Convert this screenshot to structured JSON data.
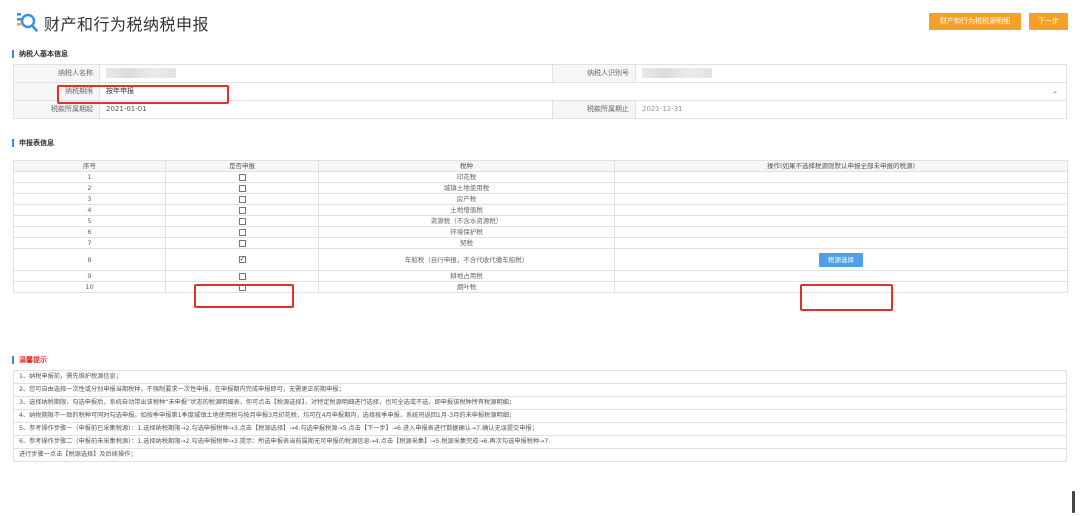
{
  "header": {
    "title": "财产和行为税纳税申报",
    "detail_button": "财产和行为税税源明细",
    "next_button": "下一步"
  },
  "basic_info": {
    "section_title": "纳税人基本信息",
    "taxpayer_name_label": "纳税人名称",
    "taxpayer_id_label": "纳税人识别号",
    "period_label": "纳税期限",
    "period_value": "按年申报",
    "start_label": "税款所属期起",
    "start_value": "2021-01-01",
    "end_label": "税款所属期止",
    "end_value": "2021-12-31"
  },
  "declaration": {
    "section_title": "申报表信息",
    "headers": [
      "序号",
      "是否申报",
      "税种",
      "操作(如果不选择税源则默认申报全部未申报的税源)"
    ],
    "rows": [
      {
        "no": "1",
        "tax": "印花税",
        "checked": false
      },
      {
        "no": "2",
        "tax": "城镇土地使用税",
        "checked": false
      },
      {
        "no": "3",
        "tax": "房产税",
        "checked": false
      },
      {
        "no": "4",
        "tax": "土地增值税",
        "checked": false
      },
      {
        "no": "5",
        "tax": "资源税（不含水资源税）",
        "checked": false
      },
      {
        "no": "6",
        "tax": "环境保护税",
        "checked": false
      },
      {
        "no": "7",
        "tax": "契税",
        "checked": false
      },
      {
        "no": "8",
        "tax": "车船税（自行申报，不含代收代缴车船税）",
        "checked": true,
        "action": "税源选择"
      },
      {
        "no": "9",
        "tax": "耕地占用税",
        "checked": false
      },
      {
        "no": "10",
        "tax": "烟叶税",
        "checked": false
      }
    ]
  },
  "tips": {
    "section_title": "温馨提示",
    "items": [
      "1、纳税申报前，需先维护税源信息；",
      "2、您可自由选择一次性或分别申报当期税种，不强制要求一次性申报，在申报期内完成申报即可，无需更正前期申报；",
      "3、选择纳税期限，勾选申报后，系统自动带出该税种“未申报”状态的税源明细表，你可点击【税源选择】，对特定税源明细进行选择，也可全选或不选，即申报该税种所有税源明细；",
      "4、纳税期限不一致的税种可同时勾选申报。如按季申报第1季度城镇土地使用税与按月申报3月印花税，均可在4月申报期内，选择按季申报，系统将返回1月-3月的未申报税源明细；",
      "5、参考操作步骤一（申报前已采集税源）：1.选择纳税期限→2.勾选申报税种→3.点击【税源选择】→4.勾选申报税源→5.点击【下一步】→6.进入申报表进行数据确认→7.确认无误提交申报；",
      "6、参考操作步骤二（申报前未采集税源）：1.选择纳税期限→2.勾选申报税种→3.提示：所选申报表当前属期无可申报的税源信息→4.点击【税源采集】→5.税源采集完成→6.再次勾选申报税种→7.",
      "进行步骤一点击【税源选择】及后续操作；"
    ]
  },
  "colors": {
    "accent_orange": "#f5a128",
    "accent_blue": "#4f9ee8",
    "highlight_red": "#e0302a"
  }
}
